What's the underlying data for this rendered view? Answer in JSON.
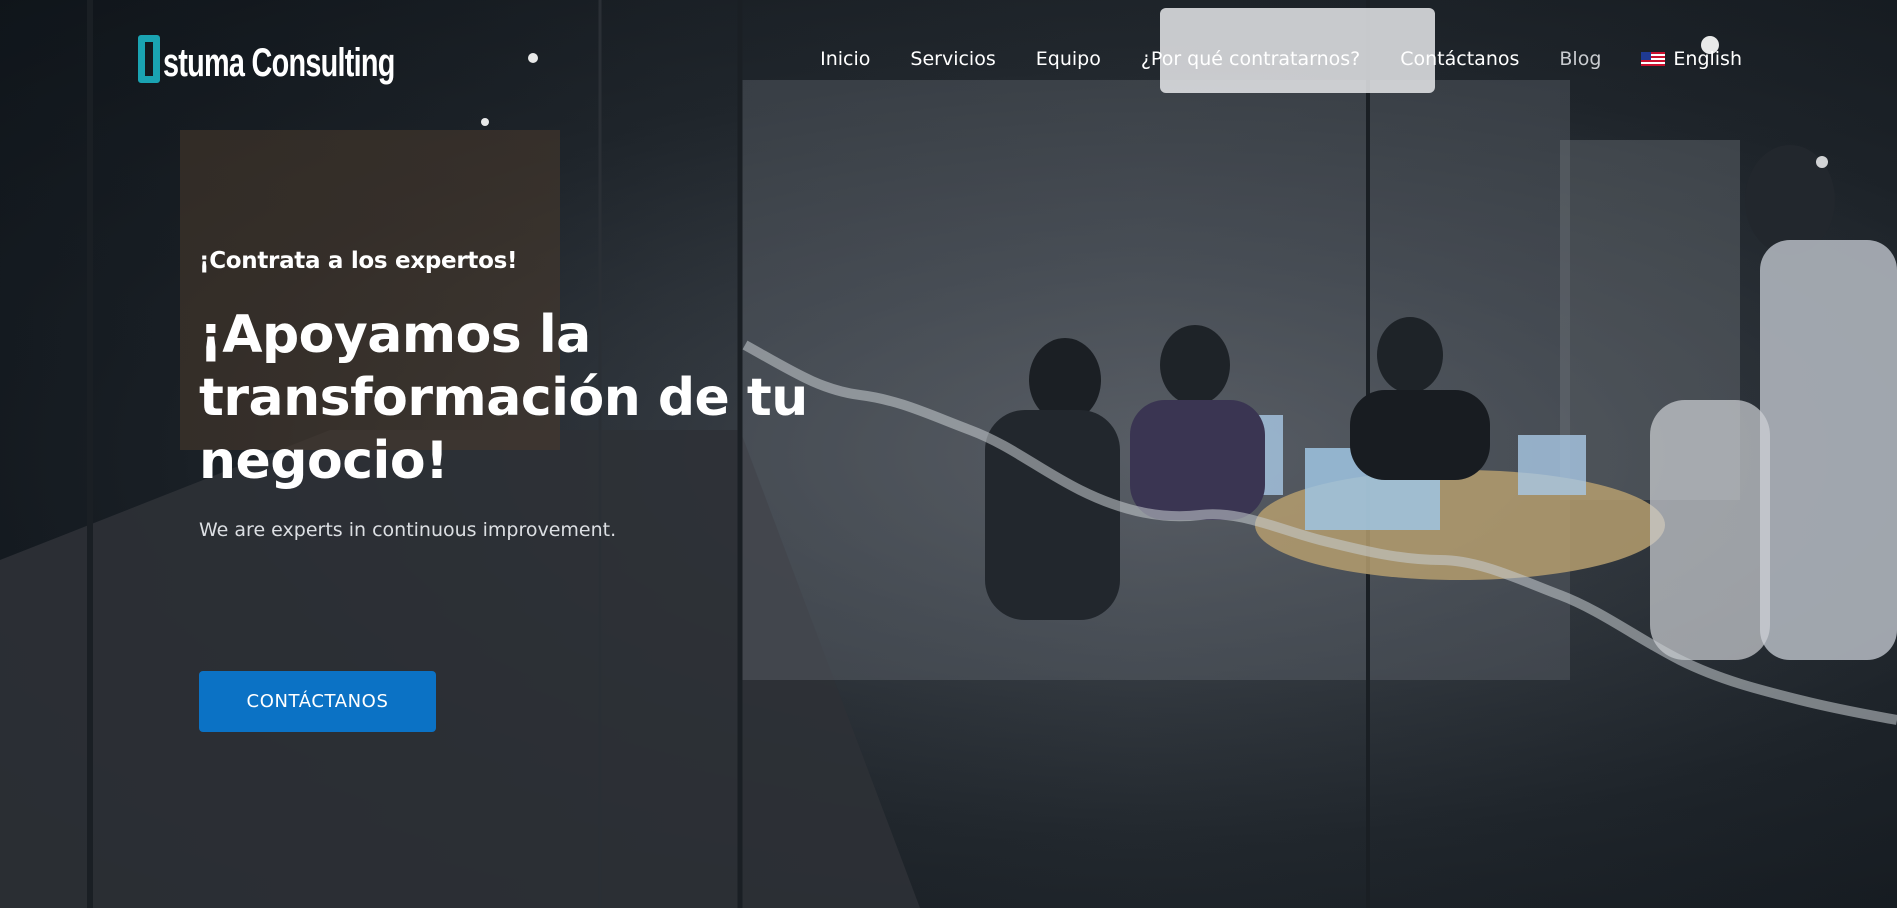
{
  "brand": {
    "logo_text": "stuma Consulting",
    "logo_mark_icon": "logo-o-mark",
    "accent_color": "#1aa3b2"
  },
  "nav": {
    "items": [
      {
        "label": "Inicio"
      },
      {
        "label": "Servicios"
      },
      {
        "label": "Equipo"
      },
      {
        "label": "¿Por qué contratarnos?"
      },
      {
        "label": "Contáctanos"
      },
      {
        "label": "Blog"
      }
    ],
    "language": {
      "label": "English",
      "icon": "us-flag-icon"
    }
  },
  "hero": {
    "eyebrow": "¡Contrata a los expertos!",
    "headline": "¡Apoyamos la transformación de tu negocio!",
    "subtitle": "We are experts in continuous improvement.",
    "cta_label": "CONTÁCTANOS",
    "cta_color": "#0b72c5",
    "background_image": "office-meeting-room-photo"
  }
}
